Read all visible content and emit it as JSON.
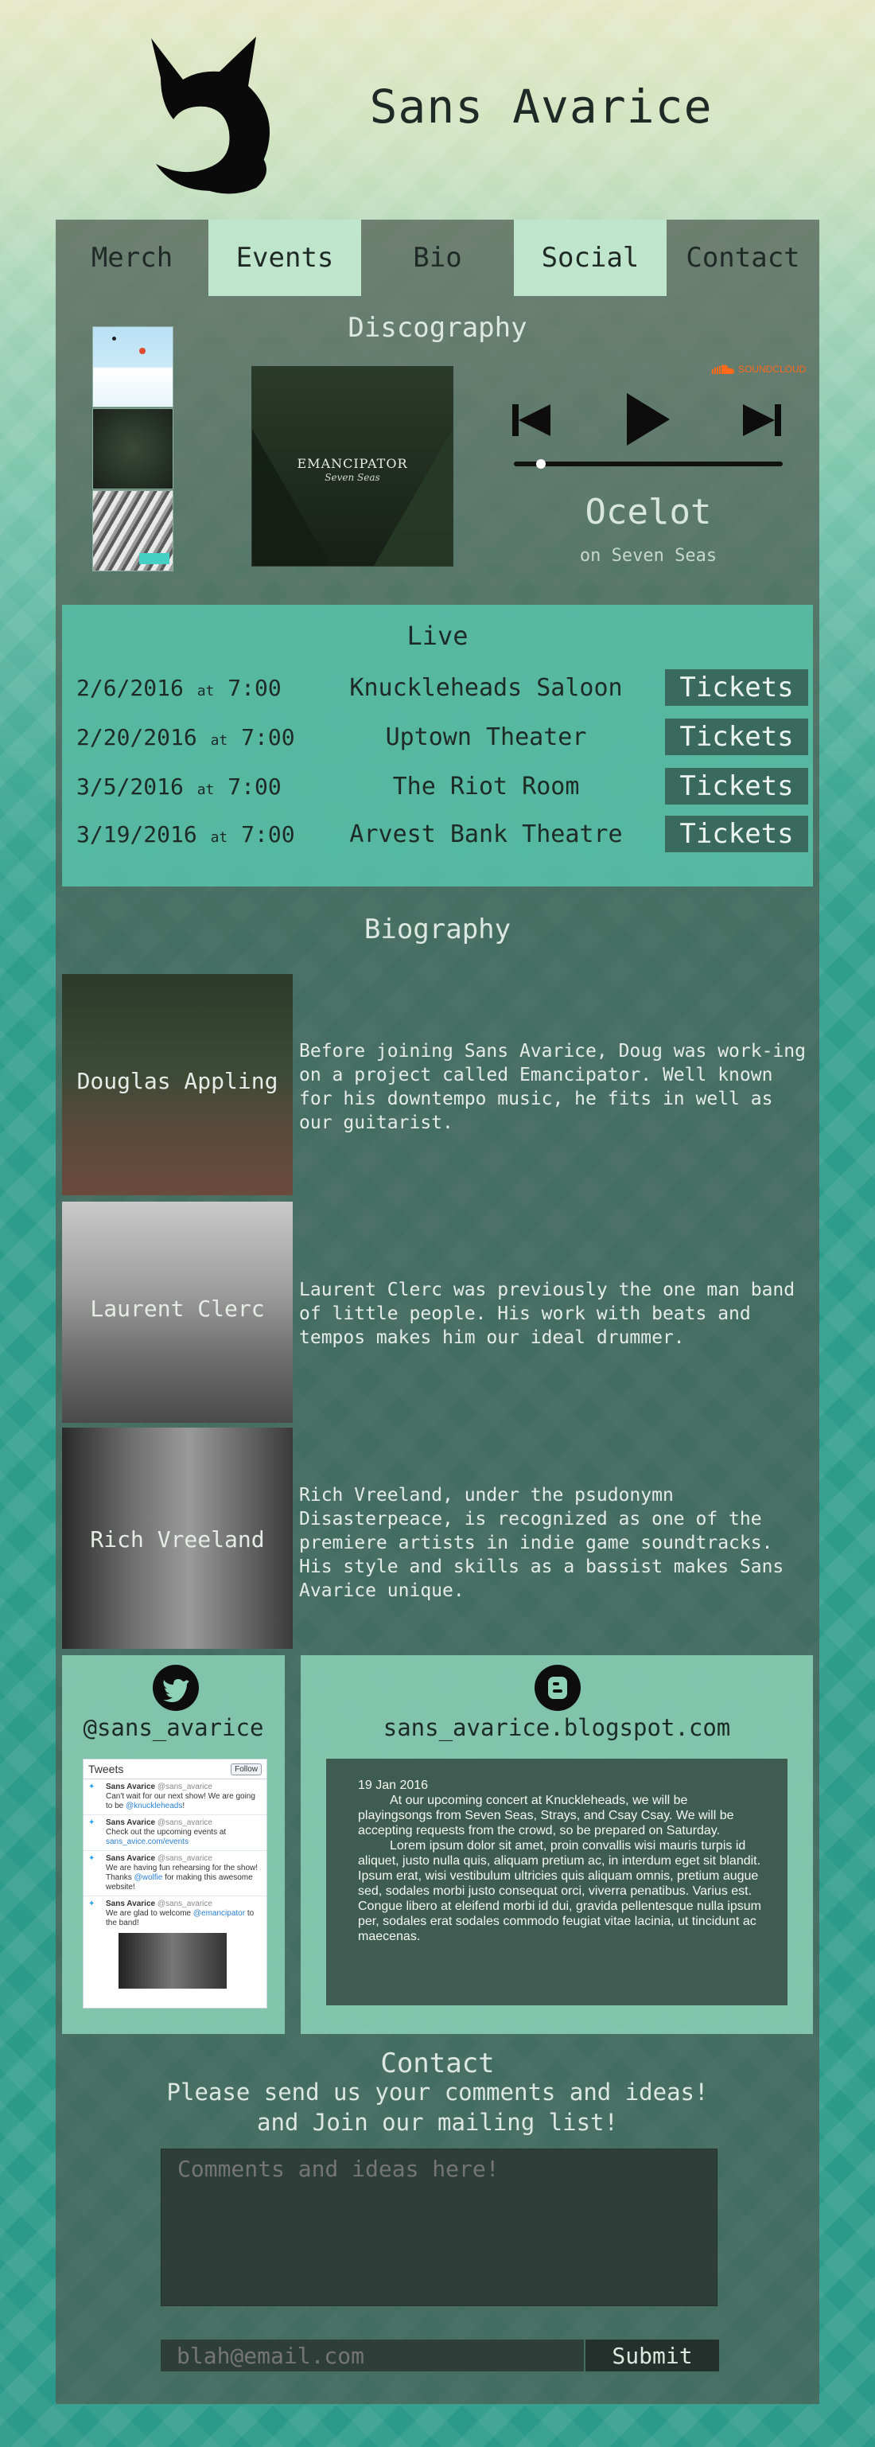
{
  "site": {
    "title": "Sans Avarice"
  },
  "nav": [
    {
      "label": "Merch"
    },
    {
      "label": "Events"
    },
    {
      "label": "Bio"
    },
    {
      "label": "Social"
    },
    {
      "label": "Contact"
    }
  ],
  "discography": {
    "title": "Discography",
    "album_name": "EMANCIPATOR",
    "album_sub": "Seven Seas",
    "soundcloud_label": "SOUNDCLOUD",
    "track_title": "Ocelot",
    "track_sub": "on Seven Seas",
    "progress": 0.1
  },
  "live": {
    "title": "Live",
    "shows": [
      {
        "date": "2/6/2016",
        "at": "at",
        "time": "7:00",
        "venue": "Knuckleheads Saloon",
        "button": "Tickets"
      },
      {
        "date": "2/20/2016",
        "at": "at",
        "time": "7:00",
        "venue": "Uptown Theater",
        "button": "Tickets"
      },
      {
        "date": "3/5/2016",
        "at": "at",
        "time": "7:00",
        "venue": "The Riot Room",
        "button": "Tickets"
      },
      {
        "date": "3/19/2016",
        "at": "at",
        "time": "7:00",
        "venue": "Arvest Bank Theatre",
        "button": "Tickets"
      }
    ]
  },
  "biography": {
    "title": "Biography",
    "members": [
      {
        "name": "Douglas Appling",
        "text": "Before joining Sans Avarice, Doug was work-ing on a project called Emancipator. Well known for his downtempo music, he fits in well as our guitarist."
      },
      {
        "name": "Laurent Clerc",
        "text": "Laurent Clerc was previously the one man band of little people. His work with beats and tempos makes him our ideal drummer."
      },
      {
        "name": "Rich Vreeland",
        "text": "Rich Vreeland, under the psudonymn Disasterpeace, is recognized as one of the premiere artists in indie game soundtracks. His style and skills as a bassist makes Sans Avarice unique."
      }
    ]
  },
  "social": {
    "twitter_handle": "@sans_avarice",
    "blog_url": "sans_avarice.blogspot.com",
    "tweets_title": "Tweets",
    "follow_label": "Follow",
    "tweets": [
      {
        "name": "Sans Avarice",
        "handle": "@sans_avarice",
        "text": "Can't wait for our next show! We are going to be",
        "link": "@knuckleheads",
        "tail": "!"
      },
      {
        "name": "Sans Avarice",
        "handle": "@sans_avarice",
        "text": "Check out the upcoming events at",
        "link": "sans_avice.com/events",
        "tail": ""
      },
      {
        "name": "Sans Avarice",
        "handle": "@sans_avarice",
        "text": "We are having fun rehearsing for the show! Thanks",
        "link": "@wolfie",
        "tail": "for making this awesome website!"
      },
      {
        "name": "Sans Avarice",
        "handle": "@sans_avarice",
        "text": "We are glad to welcome",
        "link": "@emancipator",
        "tail": "to the band!"
      }
    ],
    "blog": {
      "date": "19 Jan 2016",
      "p1": "At our upcoming concert at Knuckleheads, we will be playingsongs from Seven Seas, Strays, and Csay Csay. We will be accepting requests from the crowd, so be prepared on Saturday.",
      "p2": "Lorem ipsum dolor sit amet, proin convallis wisi mauris turpis id aliquet, justo nulla quis, aliquam pretium ac, in interdum eget sit blandit. Ipsum erat, wisi vestibulum ultricies quis aliquam omnis, pretium augue sed, sodales morbi justo consequat orci, viverra penatibus. Varius est. Congue libero at eleifend morbi id dui, gravida pellentesque nulla ipsum per, sodales erat sodales commodo feugiat vitae lacinia, ut tincidunt ac maecenas."
    }
  },
  "contact": {
    "title": "Contact",
    "line1": "Please send us your comments and ideas!",
    "line2": "and Join our mailing list!",
    "comments_placeholder": "Comments and ideas here!",
    "email_placeholder": "blah@email.com",
    "submit_label": "Submit"
  }
}
